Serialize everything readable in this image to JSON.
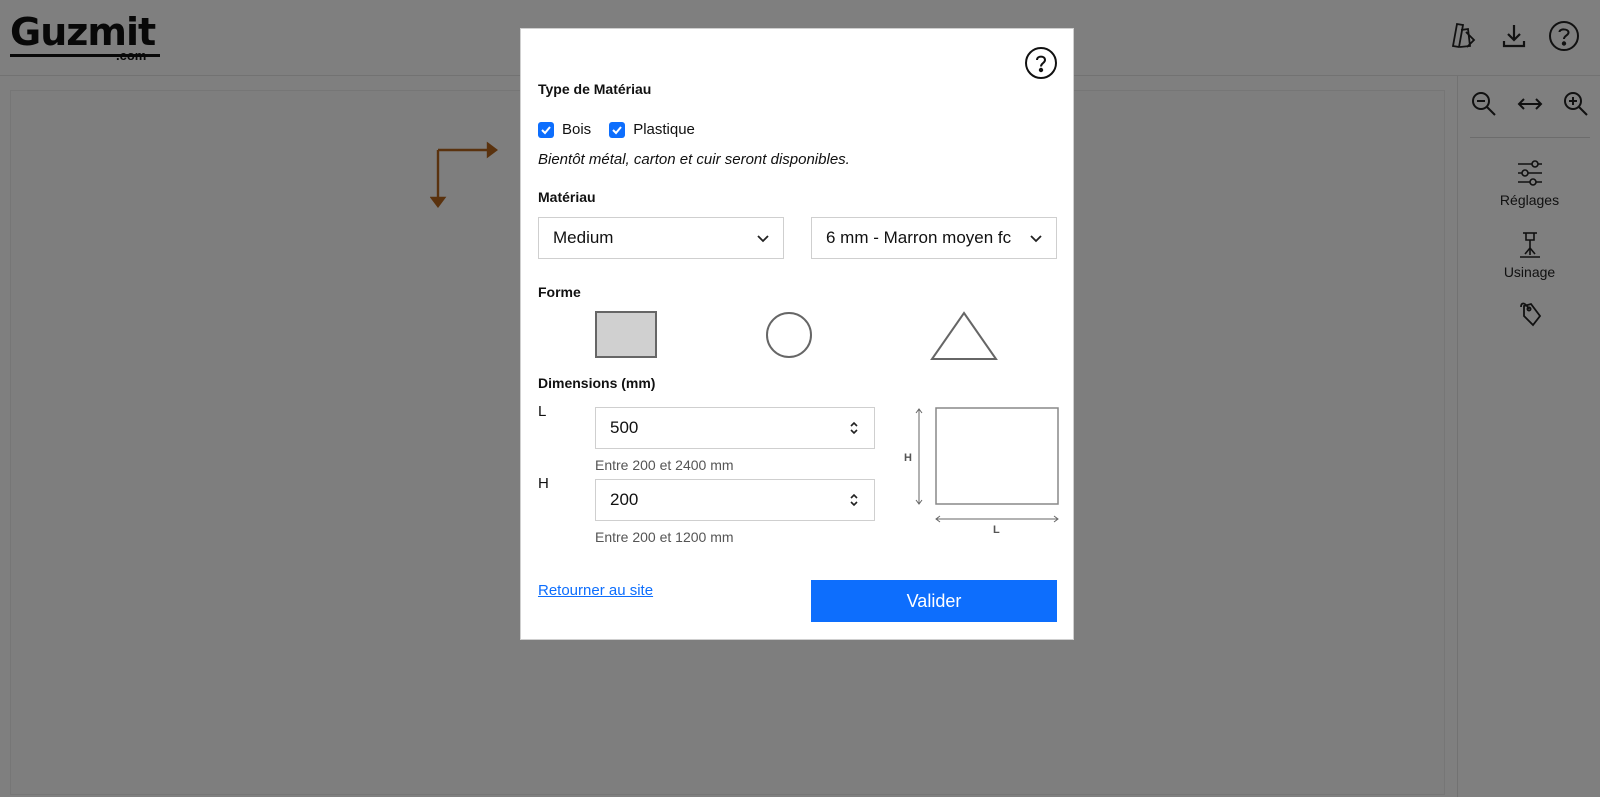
{
  "header": {
    "logo_text": "Guzmit",
    "logo_domain": ".com"
  },
  "sidebar": {
    "settings_label": "Réglages",
    "machining_label": "Usinage"
  },
  "modal": {
    "material_type_title": "Type de Matériau",
    "checkboxes": [
      {
        "label": "Bois",
        "checked": true
      },
      {
        "label": "Plastique",
        "checked": true
      }
    ],
    "note": "Bientôt métal, carton et cuir seront disponibles.",
    "material_title": "Matériau",
    "material_select": "Medium",
    "thickness_select": "6 mm - Marron moyen fc",
    "shape_title": "Forme",
    "shapes": [
      "rectangle",
      "circle",
      "triangle"
    ],
    "selected_shape": "rectangle",
    "dimensions_title": "Dimensions (mm)",
    "length_label": "L",
    "length_value": "500",
    "length_hint": "Entre 200 et 2400 mm",
    "height_label": "H",
    "height_value": "200",
    "height_hint": "Entre 200 et 1200 mm",
    "preview_h_label": "H",
    "preview_l_label": "L",
    "back_link": "Retourner au site",
    "validate_button": "Valider"
  },
  "colors": {
    "accent": "#0d6efd",
    "origin_arrow": "#b5651d"
  }
}
